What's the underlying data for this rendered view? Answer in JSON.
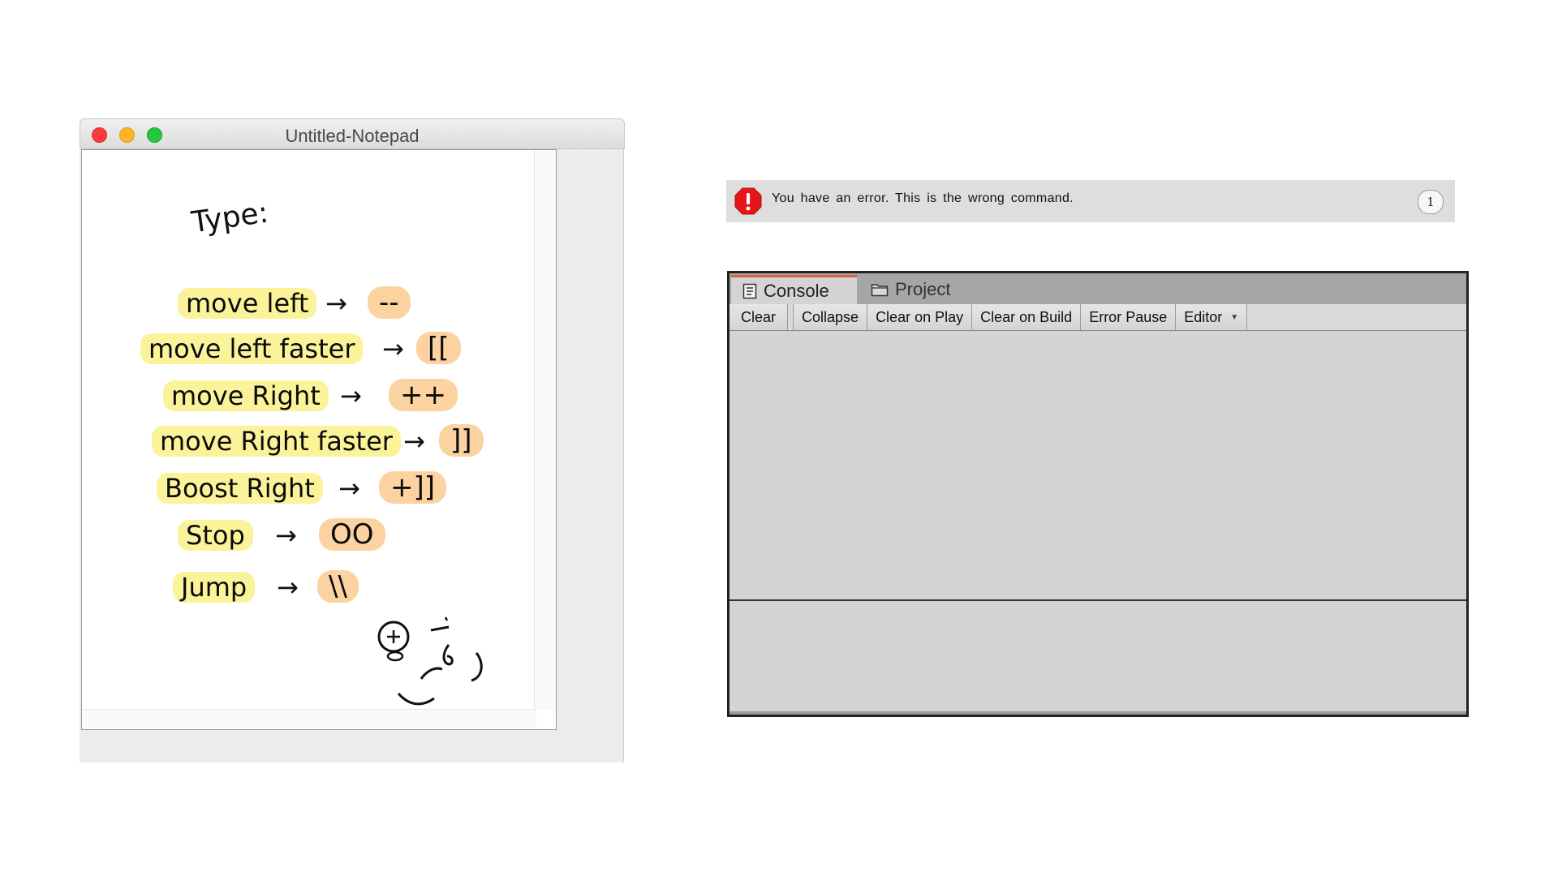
{
  "notepad": {
    "title": "Untitled-Notepad",
    "heading": "Type:",
    "commands": [
      {
        "label": "move left",
        "arrow": "→",
        "key": "--"
      },
      {
        "label": "move left faster",
        "arrow": "→",
        "key": "[["
      },
      {
        "label": "move Right",
        "arrow": "→",
        "key": "++"
      },
      {
        "label": "move Right faster",
        "arrow": "→",
        "key": "]]"
      },
      {
        "label": "Boost Right",
        "arrow": "→",
        "key": "+]]"
      },
      {
        "label": "Stop",
        "arrow": "→",
        "key": "OO"
      },
      {
        "label": "Jump",
        "arrow": "→",
        "key": "\\\\"
      }
    ]
  },
  "error_bar": {
    "message": "You have an error. This is the wrong command.",
    "count": "1",
    "icon": "error-octagon-icon",
    "icon_color": "#e8141b"
  },
  "console": {
    "tabs": [
      {
        "label": "Console",
        "icon": "console-icon",
        "active": true
      },
      {
        "label": "Project",
        "icon": "folder-icon",
        "active": false
      }
    ],
    "toolbar": [
      "Clear",
      "Collapse",
      "Clear on Play",
      "Clear on Build",
      "Error Pause",
      "Editor"
    ],
    "active_tab_accent": "#e0603b"
  }
}
